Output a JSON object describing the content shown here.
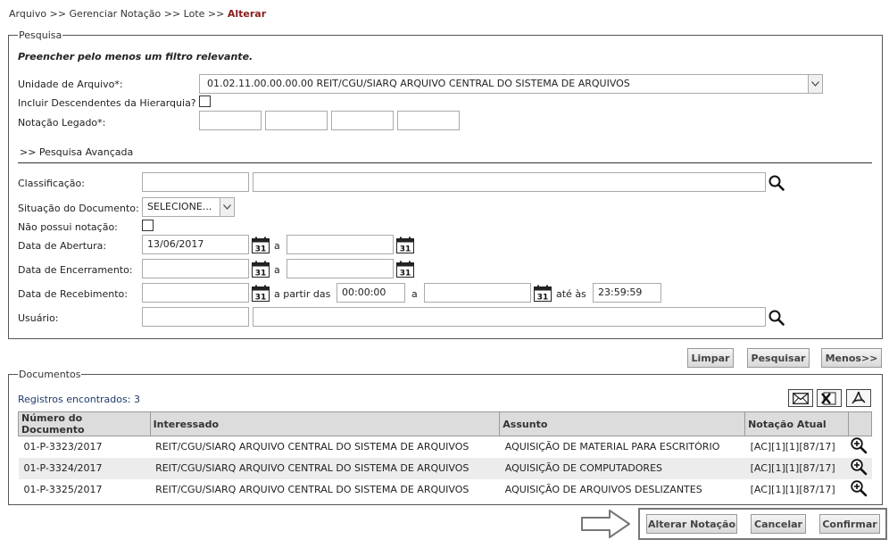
{
  "breadcrumb": {
    "part1": "Arquivo >> Gerenciar Notação >> Lote >> ",
    "current": "Alterar"
  },
  "search": {
    "legend": "Pesquisa",
    "hint": "Preencher pelo menos um filtro relevante.",
    "unit_label": "Unidade de Arquivo*:",
    "unit_value": "01.02.11.00.00.00.00 REIT/CGU/SIARQ ARQUIVO CENTRAL DO SISTEMA DE ARQUIVOS",
    "include_desc_label": "Incluir Descendentes da Hierarquia?",
    "notacao_label": "Notação Legado*:",
    "advanced_label": ">> Pesquisa Avançada",
    "classificacao_label": "Classificação:",
    "situacao_label": "Situação do Documento:",
    "situacao_value": "SELECIONE...",
    "sem_notacao_label": "Não possui notação:",
    "abertura_label": "Data de Abertura:",
    "abertura_value": "13/06/2017",
    "encerramento_label": "Data de Encerramento:",
    "recebimento_label": "Data de Recebimento:",
    "a_label": "a",
    "a_partir_label": "a partir das",
    "ate_label": "até às",
    "hora_inicio": "00:00:00",
    "hora_fim": "23:59:59",
    "usuario_label": "Usuário:",
    "cal_day": "31"
  },
  "actions": {
    "limpar": "Limpar",
    "pesquisar": "Pesquisar",
    "menos": "Menos>>"
  },
  "documents": {
    "legend": "Documentos",
    "count_text": "Registros encontrados: 3",
    "columns": [
      "Número do Documento",
      "Interessado",
      "Assunto",
      "Notação Atual"
    ],
    "rows": [
      [
        "01-P-3323/2017",
        "REIT/CGU/SIARQ ARQUIVO CENTRAL DO SISTEMA DE ARQUIVOS",
        "AQUISIÇÃO DE MATERIAL PARA ESCRITÓRIO",
        "[AC][1][1][87/17]"
      ],
      [
        "01-P-3324/2017",
        "REIT/CGU/SIARQ ARQUIVO CENTRAL DO SISTEMA DE ARQUIVOS",
        "AQUISIÇÃO DE COMPUTADORES",
        "[AC][1][1][87/17]"
      ],
      [
        "01-P-3325/2017",
        "REIT/CGU/SIARQ ARQUIVO CENTRAL DO SISTEMA DE ARQUIVOS",
        "AQUISIÇÃO DE ARQUIVOS DESLIZANTES",
        "[AC][1][1][87/17]"
      ]
    ]
  },
  "footer": {
    "alterar": "Alterar Notação",
    "cancelar": "Cancelar",
    "confirmar": "Confirmar"
  },
  "icons": {
    "email": "envelope-icon",
    "excel": "excel-icon",
    "pdf": "pdf-icon",
    "search": "magnifier-icon",
    "calendar": "calendar-icon",
    "zoom": "zoom-in-icon",
    "arrow": "arrow-right-icon"
  }
}
